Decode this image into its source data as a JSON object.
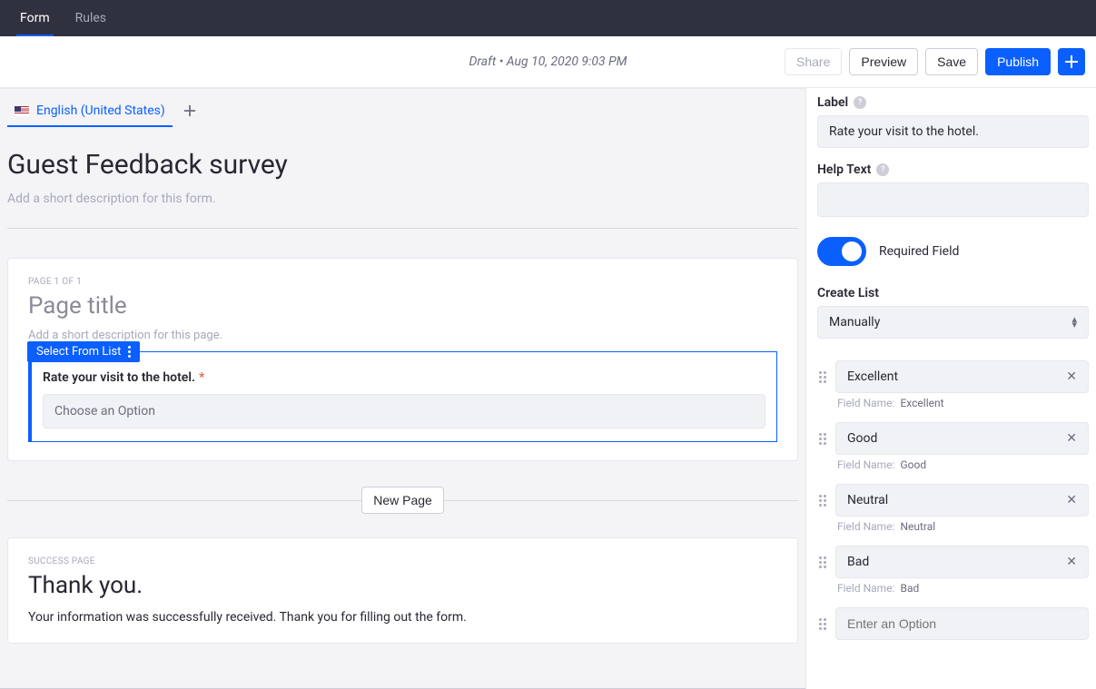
{
  "top_tabs": {
    "form": "Form",
    "rules": "Rules"
  },
  "action_bar": {
    "status": "Draft • Aug 10, 2020 9:03 PM",
    "share": "Share",
    "preview": "Preview",
    "save": "Save",
    "publish": "Publish"
  },
  "language": {
    "label": "English (United States)"
  },
  "form": {
    "title": "Guest Feedback survey",
    "desc_placeholder": "Add a short description for this form."
  },
  "page": {
    "page_counter": "PAGE 1 OF 1",
    "title": "Page title",
    "desc_placeholder": "Add a short description for this page.",
    "field_badge": "Select From List",
    "field_label": "Rate your visit to the hotel.",
    "field_control_placeholder": "Choose an Option"
  },
  "new_page_btn": "New Page",
  "success": {
    "label": "SUCCESS PAGE",
    "title": "Thank you.",
    "body": "Your information was successfully received. Thank you for filling out the form."
  },
  "sidebar": {
    "label_label": "Label",
    "label_value": "Rate your visit to the hotel.",
    "help_label": "Help Text",
    "help_value": "",
    "required_label": "Required Field",
    "create_list_label": "Create List",
    "create_list_value": "Manually",
    "field_name_label": "Field Name:",
    "options": [
      {
        "value": "Excellent",
        "field_name": "Excellent"
      },
      {
        "value": "Good",
        "field_name": "Good"
      },
      {
        "value": "Neutral",
        "field_name": "Neutral"
      },
      {
        "value": "Bad",
        "field_name": "Bad"
      }
    ],
    "option_placeholder": "Enter an Option"
  }
}
